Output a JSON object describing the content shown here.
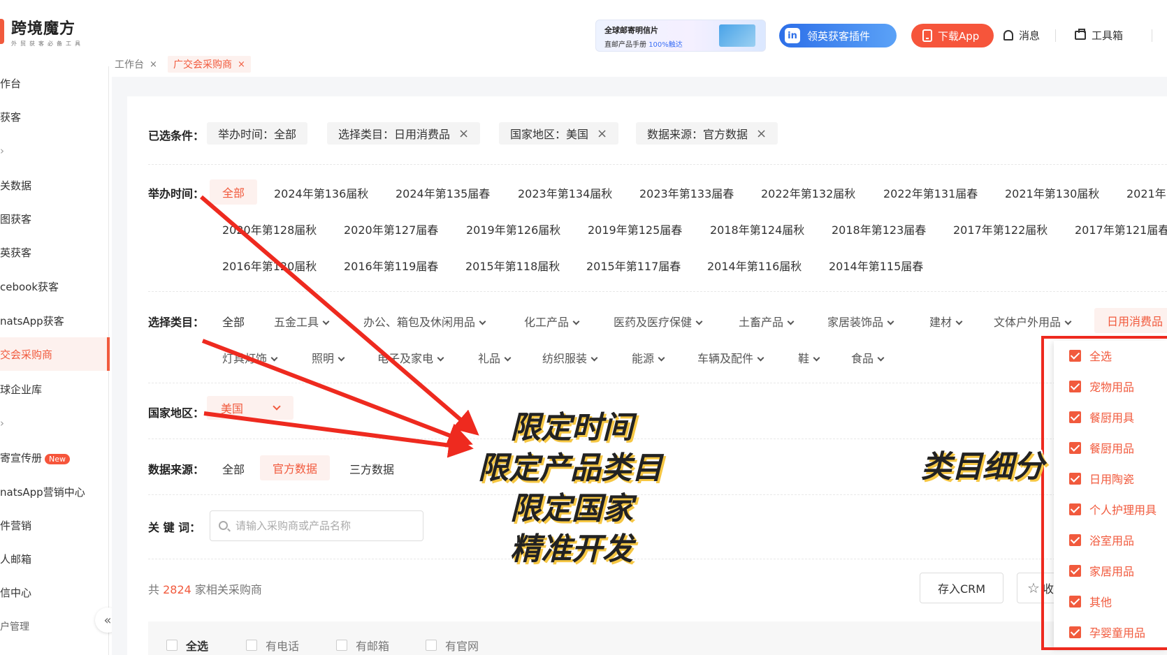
{
  "logo": {
    "title": "跨境魔方",
    "subtitle": "外贸获客必备工具"
  },
  "banner": {
    "line1": "全球邮寄明信片",
    "line2_prefix": "直邮产品手册 ",
    "line2_highlight": "100%触达"
  },
  "header": {
    "linkedin_label": "领英获客插件",
    "app_label": "下载App",
    "messages_label": "消息",
    "toolbox_label": "工具箱"
  },
  "sidebar": {
    "items": [
      "作台",
      "获客",
      "",
      "关数据",
      "图获客",
      "英获客",
      "cebook获客",
      "natsApp获客",
      "交会采购商",
      "球企业库",
      "",
      "寄宣传册",
      "natsApp营销中心",
      "件营销",
      "人邮箱",
      "信中心",
      "户管理"
    ],
    "new_badge": "New",
    "collapse_icon": "«"
  },
  "tabs": [
    {
      "label": "工作台",
      "close": "×"
    },
    {
      "label": "广交会采购商",
      "close": "×"
    }
  ],
  "filters": {
    "selected_label": "已选条件：",
    "chips": [
      {
        "label": "举办时间：全部",
        "close": ""
      },
      {
        "label": "选择类目：日用消费品",
        "close": "×"
      },
      {
        "label": "国家地区：美国",
        "close": "×"
      },
      {
        "label": "数据来源：官方数据",
        "close": "×"
      }
    ],
    "time_label": "举办时间：",
    "time_options": [
      "全部",
      "2024年第136届秋",
      "2024年第135届春",
      "2023年第134届秋",
      "2023年第133届春",
      "2022年第132届秋",
      "2022年第131届春",
      "2021年第130届秋",
      "2021年",
      "2020年第128届秋",
      "2020年第127届春",
      "2019年第126届秋",
      "2019年第125届春",
      "2018年第124届秋",
      "2018年第123届春",
      "2017年第122届秋",
      "2017年第121届春",
      "2016年第120届秋",
      "2016年第119届春",
      "2015年第118届秋",
      "2015年第117届春",
      "2014年第116届秋",
      "2014年第115届春"
    ],
    "category_label": "选择类目：",
    "category_all": "全部",
    "categories": [
      "五金工具",
      "办公、箱包及休闲用品",
      "化工产品",
      "医药及医疗保健",
      "土畜产品",
      "家居装饰品",
      "建材",
      "文体户外用品",
      "日用消费品",
      "灯具灯饰",
      "照明",
      "电子及家电",
      "礼品",
      "纺织服装",
      "能源",
      "车辆及配件",
      "鞋",
      "食品"
    ],
    "country_label": "国家地区：",
    "country_value": "美国",
    "source_label": "数据来源：",
    "source_options": [
      "全部",
      "官方数据",
      "三方数据"
    ],
    "keyword_label": "关 键 词：",
    "keyword_placeholder": "请输入采购商或产品名称"
  },
  "results": {
    "prefix": "共 ",
    "count": "2824",
    "suffix": " 家相关采购商",
    "crm_label": "存入CRM",
    "fav_label": "收"
  },
  "checkbox_row": [
    "全选",
    "有电话",
    "有邮箱",
    "有官网"
  ],
  "subcategories": [
    "全选",
    "宠物用品",
    "餐厨用具",
    "餐厨用品",
    "日用陶瓷",
    "个人护理用具",
    "浴室用品",
    "家居用品",
    "其他",
    "孕婴童用品"
  ],
  "captions": {
    "left": [
      "限定时间",
      "限定产品类目",
      "限定国家",
      "精准开发"
    ],
    "right": "类目细分"
  },
  "colors": {
    "accent": "#f15a3d",
    "linkedin": "#2d6fe8",
    "arrow": "#ee2a1f"
  }
}
